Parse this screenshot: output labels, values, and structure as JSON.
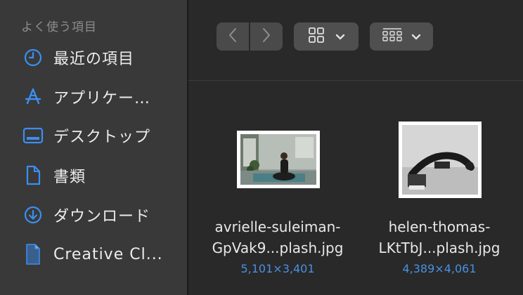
{
  "sidebar": {
    "section_title": "よく使う項目",
    "items": [
      {
        "label": "最近の項目",
        "icon": "clock-icon"
      },
      {
        "label": "アプリケー…",
        "icon": "applications-icon"
      },
      {
        "label": "デスクトップ",
        "icon": "desktop-icon"
      },
      {
        "label": "書類",
        "icon": "document-icon"
      },
      {
        "label": "ダウンロード",
        "icon": "download-icon"
      },
      {
        "label": "Creative Cl...",
        "icon": "file-icon"
      }
    ]
  },
  "toolbar": {
    "back": "back-chevron-icon",
    "forward": "forward-chevron-icon",
    "view": "grid-view-icon",
    "group": "group-by-icon"
  },
  "files": [
    {
      "name_line1": "avrielle-suleiman-",
      "name_line2": "GpVak9...plash.jpg",
      "dimensions": "5,101×3,401"
    },
    {
      "name_line1": "helen-thomas-",
      "name_line2": "LKtTbJ...plash.jpg",
      "dimensions": "4,389×4,061"
    }
  ],
  "colors": {
    "accent": "#4a90e2",
    "sidebar_bg": "#39393a",
    "main_bg": "#29292a"
  }
}
